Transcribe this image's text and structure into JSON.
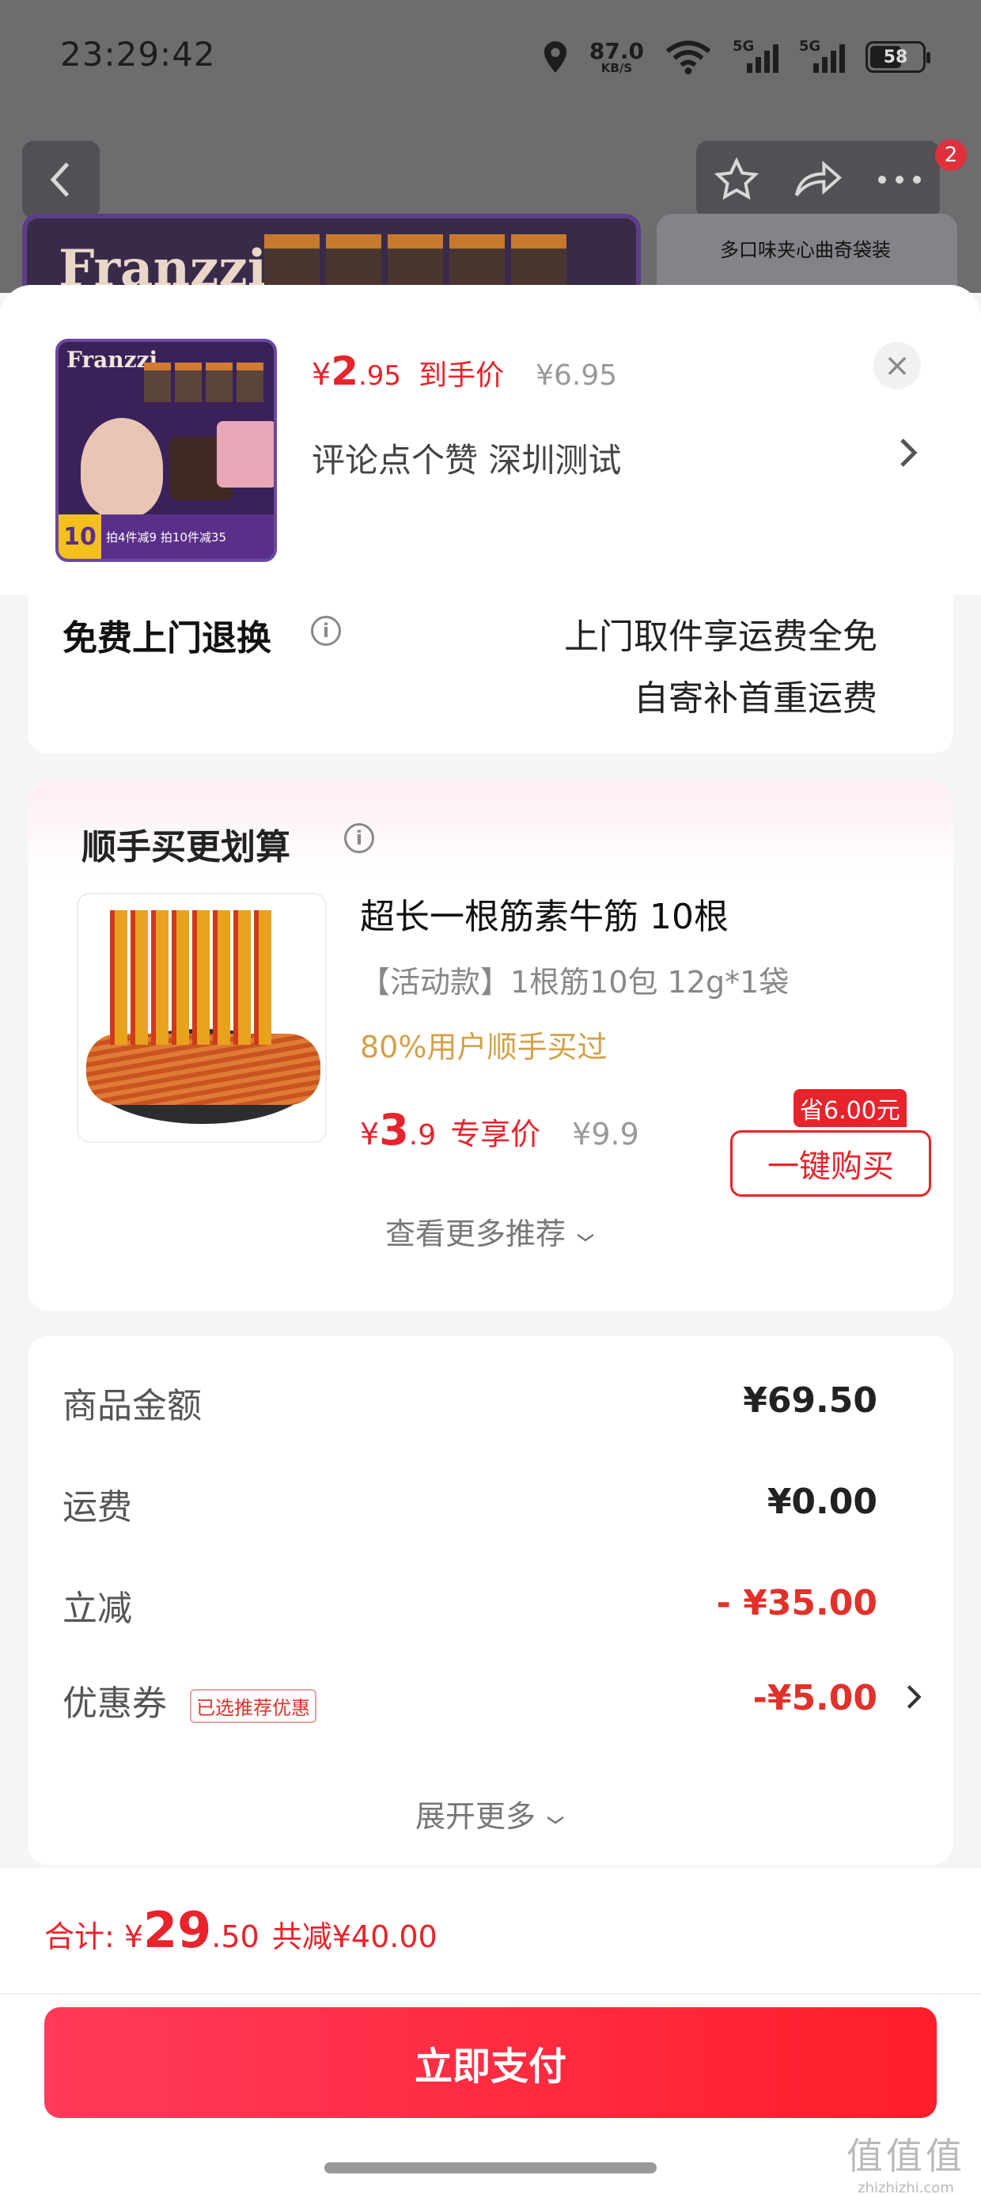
{
  "status_bar": {
    "time": "23:29:42",
    "net_speed": "87.0",
    "net_speed_unit": "KB/S",
    "sim1": "5G",
    "sim2": "5G",
    "battery": "58"
  },
  "nav": {
    "badge_count": "2",
    "banner_brand": "Franzzi",
    "banner_right_text": "多口味夹心曲奇袋装"
  },
  "product": {
    "thumb_brand": "Franzzi",
    "thumb_promo_num": "10",
    "thumb_promo_text": "拍4件减9 拍10件减35",
    "currency": "¥",
    "price_int": "2",
    "price_dec": ".95",
    "price_label": "到手价",
    "original_price": "¥6.95",
    "spec": "评论点个赞  深圳测试",
    "close_label": "×"
  },
  "return_policy": {
    "title": "免费上门退换",
    "line1": "上门取件享运费全免",
    "line2": "自寄补首重运费"
  },
  "addon": {
    "section_title": "顺手买更划算",
    "name": "超长一根筋素牛筋 10根",
    "spec": "【活动款】1根筋10包   12g*1袋",
    "social_proof": "80%用户顺手买过",
    "currency": "¥",
    "price_int": "3",
    "price_dec": ".9",
    "price_label": "专享价",
    "original_price": "¥9.9",
    "save_tag": "省6.00元",
    "buy_button": "一键购买",
    "more_recommend": "查看更多推荐"
  },
  "summary": {
    "rows": [
      {
        "label": "商品金额",
        "value": "¥69.50"
      },
      {
        "label": "运费",
        "value": "¥0.00"
      },
      {
        "label": "立减",
        "value": "- ¥35.00"
      },
      {
        "label": "优惠券",
        "value": "-¥5.00"
      }
    ],
    "coupon_tag": "已选推荐优惠",
    "expand_more": "展开更多"
  },
  "footer": {
    "total_label": "合计:",
    "currency": "¥",
    "total_int": "29",
    "total_dec": ".50",
    "total_saved": "共减¥40.00",
    "pay_button": "立即支付",
    "watermark_main": "值值值",
    "watermark_sub": "zhizhizhi.com"
  },
  "colors": {
    "accent_red": "#e8232b",
    "gold": "#d4a04a"
  }
}
